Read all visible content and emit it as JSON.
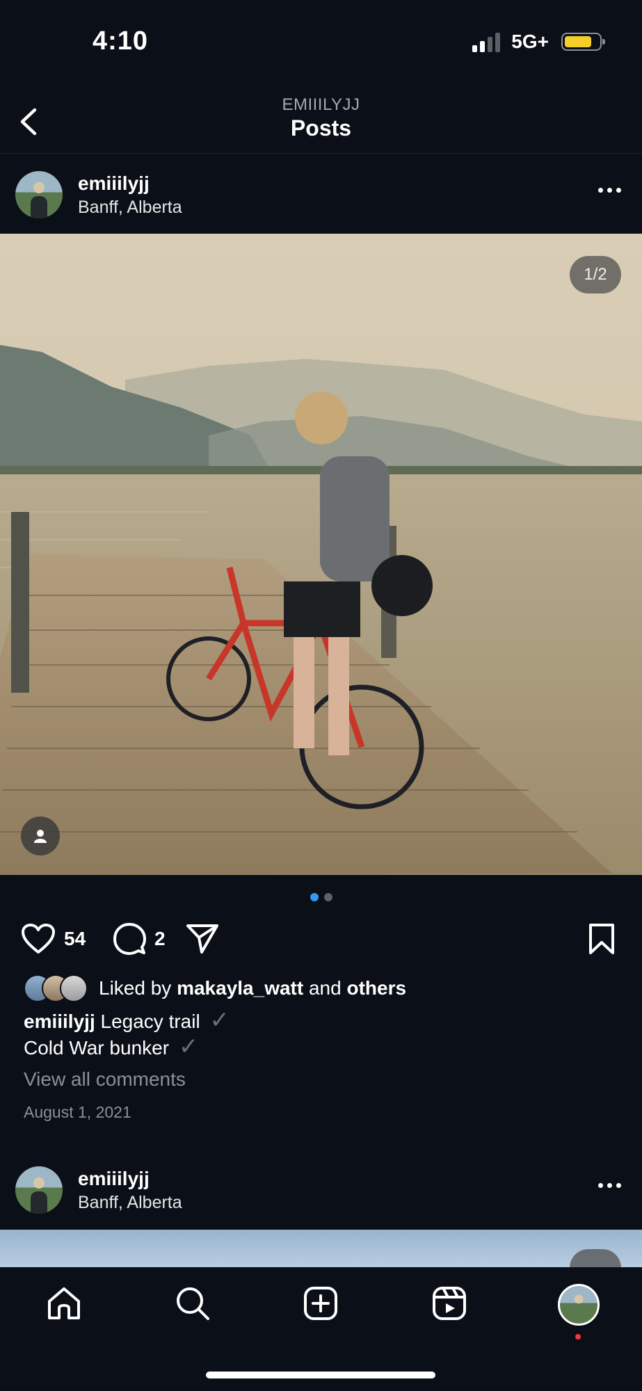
{
  "status_bar": {
    "time": "4:10",
    "network": "5G+",
    "signal_bars": 2,
    "battery_level": 0.75,
    "battery_color": "#f4cf2a"
  },
  "header": {
    "subtitle": "EMIIILYJJ",
    "title": "Posts"
  },
  "post1": {
    "username": "emiiilyjj",
    "location": "Banff, Alberta",
    "media_counter": "1/2",
    "carousel_active_index": 0,
    "carousel_count": 2,
    "like_count": "54",
    "comment_count": "2",
    "liked_by_prefix": "Liked by",
    "liked_by_user": "makayla_watt",
    "liked_by_and": "and",
    "liked_by_others": "others",
    "caption_user": "emiiilyjj",
    "caption_line1": "Legacy trail",
    "caption_line2": "Cold War bunker",
    "check_glyph": "✓",
    "view_comments": "View all comments",
    "date": "August 1, 2021"
  },
  "post2": {
    "username": "emiiilyjj",
    "location": "Banff, Alberta"
  },
  "icons": {
    "back": "chevron-left-icon",
    "more": "more-horizontal-icon",
    "like": "heart-icon",
    "comment": "comment-icon",
    "share": "send-icon",
    "save": "bookmark-icon",
    "home": "home-icon",
    "search": "search-icon",
    "create": "plus-square-icon",
    "reels": "reels-icon",
    "profile": "profile-avatar",
    "tag": "user-tag-icon"
  },
  "colors": {
    "background": "#0b0f17",
    "accent": "#3897f0",
    "notification": "#ff3040"
  }
}
